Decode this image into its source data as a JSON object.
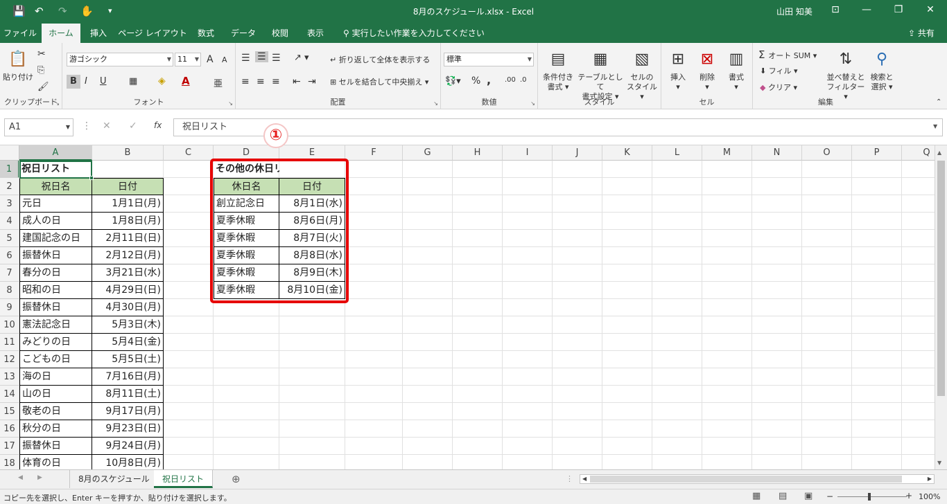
{
  "window": {
    "title": "8月のスケジュール.xlsx  -  Excel",
    "user": "山田 知美",
    "quick_access": {
      "save": "💾",
      "undo": "↶",
      "redo": "↷",
      "touch": "✋",
      "more": "▾"
    },
    "controls": {
      "ribbon_opts": "⊡",
      "minimize": "—",
      "restore": "❐",
      "close": "✕"
    }
  },
  "tabs": [
    "ファイル",
    "ホーム",
    "挿入",
    "ページ レイアウト",
    "数式",
    "データ",
    "校閲",
    "表示"
  ],
  "tell_me": "実行したい作業を入力してください",
  "share": "共有",
  "ribbon": {
    "clipboard": {
      "label": "クリップボード",
      "paste": "貼り付け"
    },
    "font": {
      "label": "フォント",
      "name": "游ゴシック",
      "size": "11",
      "bold": "B",
      "italic": "I",
      "underline": "U",
      "grow": "A",
      "shrink": "A"
    },
    "alignment": {
      "label": "配置",
      "wrap": "折り返して全体を表示する",
      "merge": "セルを結合して中央揃え"
    },
    "number": {
      "label": "数値",
      "format": "標準",
      "percent": "%",
      "comma": ","
    },
    "styles": {
      "label": "スタイル",
      "conditional": [
        "条件付き",
        "書式"
      ],
      "table": [
        "テーブルとして",
        "書式設定"
      ],
      "cell": [
        "セルの",
        "スタイル"
      ]
    },
    "cells": {
      "label": "セル",
      "insert": "挿入",
      "delete": "削除",
      "format": "書式"
    },
    "editing": {
      "label": "編集",
      "autosum": "オート SUM",
      "fill": "フィル",
      "clear": "クリア",
      "sort": [
        "並べ替えと",
        "フィルター"
      ],
      "find": [
        "検索と",
        "選択"
      ]
    }
  },
  "formula_bar": {
    "name_box": "A1",
    "cancel": "✕",
    "enter": "✓",
    "fx": "fx",
    "content": "祝日リスト"
  },
  "annotation": "①",
  "columns": [
    "A",
    "B",
    "C",
    "D",
    "E",
    "F",
    "G",
    "H",
    "I",
    "J",
    "K",
    "L",
    "M",
    "N",
    "O",
    "P",
    "Q"
  ],
  "rows": [
    "1",
    "2",
    "3",
    "4",
    "5",
    "6",
    "7",
    "8",
    "9",
    "10",
    "11",
    "12",
    "13",
    "14",
    "15",
    "16",
    "17",
    "18"
  ],
  "holiday_list": {
    "title": "祝日リスト",
    "headers": [
      "祝日名",
      "日付"
    ],
    "rows": [
      [
        "元日",
        "1月1日(月)"
      ],
      [
        "成人の日",
        "1月8日(月)"
      ],
      [
        "建国記念の日",
        "2月11日(日)"
      ],
      [
        "振替休日",
        "2月12日(月)"
      ],
      [
        "春分の日",
        "3月21日(水)"
      ],
      [
        "昭和の日",
        "4月29日(日)"
      ],
      [
        "振替休日",
        "4月30日(月)"
      ],
      [
        "憲法記念日",
        "5月3日(木)"
      ],
      [
        "みどりの日",
        "5月4日(金)"
      ],
      [
        "こどもの日",
        "5月5日(土)"
      ],
      [
        "海の日",
        "7月16日(月)"
      ],
      [
        "山の日",
        "8月11日(土)"
      ],
      [
        "敬老の日",
        "9月17日(月)"
      ],
      [
        "秋分の日",
        "9月23日(日)"
      ],
      [
        "振替休日",
        "9月24日(月)"
      ],
      [
        "体育の日",
        "10月8日(月)"
      ]
    ]
  },
  "other_list": {
    "title": "その他の休日リスト",
    "headers": [
      "休日名",
      "日付"
    ],
    "rows": [
      [
        "創立記念日",
        "8月1日(水)"
      ],
      [
        "夏季休暇",
        "8月6日(月)"
      ],
      [
        "夏季休暇",
        "8月7日(火)"
      ],
      [
        "夏季休暇",
        "8月8日(水)"
      ],
      [
        "夏季休暇",
        "8月9日(木)"
      ],
      [
        "夏季休暇",
        "8月10日(金)"
      ]
    ]
  },
  "sheets": [
    "8月のスケジュール",
    "祝日リスト"
  ],
  "active_sheet": "祝日リスト",
  "status": {
    "message": "コピー先を選択し、Enter キーを押すか、貼り付けを選択します。",
    "zoom": "100%"
  },
  "colors": {
    "brand": "#217346",
    "header_fill": "#c6e0b4",
    "highlight": "#e60000"
  }
}
